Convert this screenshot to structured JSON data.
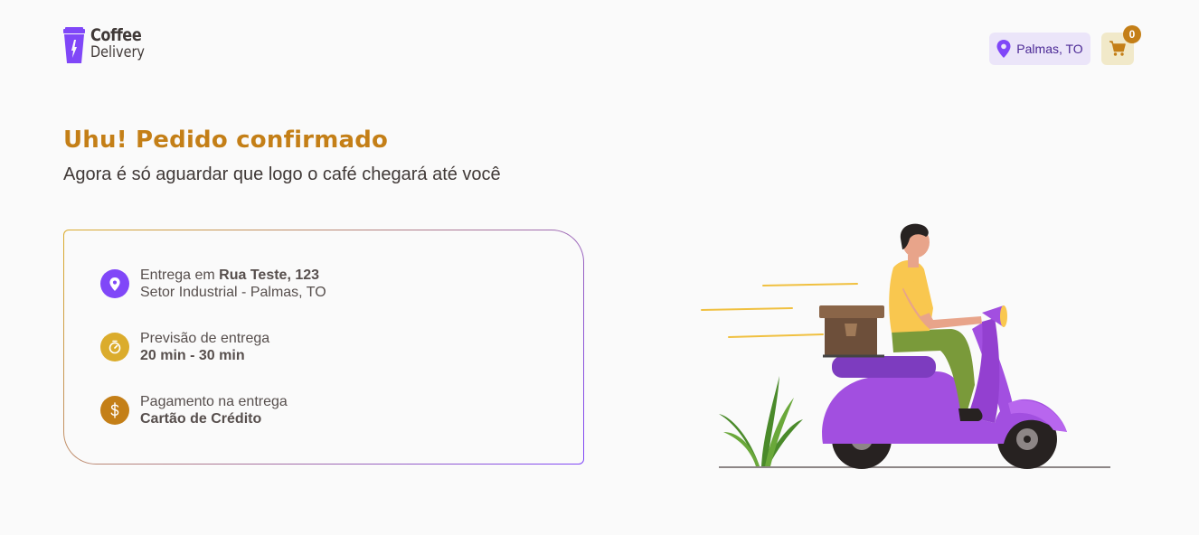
{
  "header": {
    "logo": {
      "line1": "Coffee",
      "line2": "Delivery",
      "icon": "coffee-cup-icon"
    },
    "location": {
      "text": "Palmas, TO",
      "icon": "map-pin-icon"
    },
    "cart": {
      "count": "0",
      "icon": "shopping-cart-icon"
    }
  },
  "confirmation": {
    "title": "Uhu! Pedido confirmado",
    "subtitle": "Agora é só aguardar que logo o café chegará até você"
  },
  "details": {
    "delivery": {
      "prefix": "Entrega em ",
      "street": "Rua Teste, 123",
      "area": "Setor Industrial - Palmas, TO",
      "icon": "map-pin-icon"
    },
    "forecast": {
      "label": "Previsão de entrega",
      "value": "20 min - 30 min",
      "icon": "timer-icon"
    },
    "payment": {
      "label": "Pagamento na entrega",
      "value": "Cartão de Crédito",
      "icon": "currency-dollar-icon"
    }
  },
  "colors": {
    "purple": "#8047f8",
    "purple_dark": "#4b2995",
    "purple_light": "#ebe5f9",
    "yellow": "#dbac2c",
    "yellow_dark": "#c47f17",
    "yellow_light": "#f1e9c9",
    "text": "#574f4d",
    "title": "#403937",
    "background": "#fafafa"
  }
}
